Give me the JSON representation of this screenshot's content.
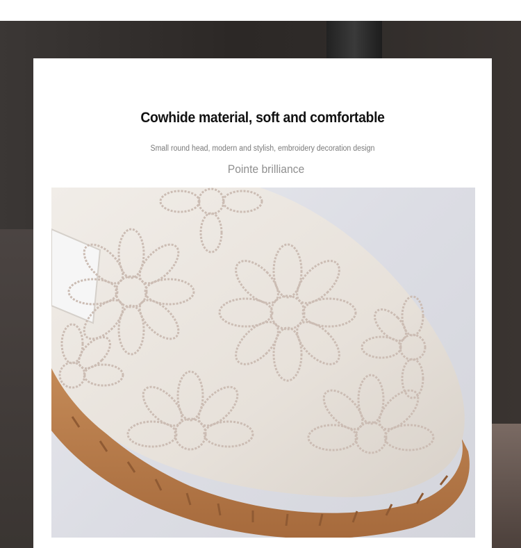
{
  "headline": "Cowhide material, soft and comfortable",
  "subline": "Small round head, modern and stylish, embroidery decoration design",
  "tagline": "Pointe brilliance",
  "image": {
    "subject": "shoe-closeup-photo",
    "shoe_color": "#ebe6df",
    "embroidery_color": "#cbbcb3",
    "sole_color": "#b97a4a",
    "background_color": "#dcdde4"
  }
}
